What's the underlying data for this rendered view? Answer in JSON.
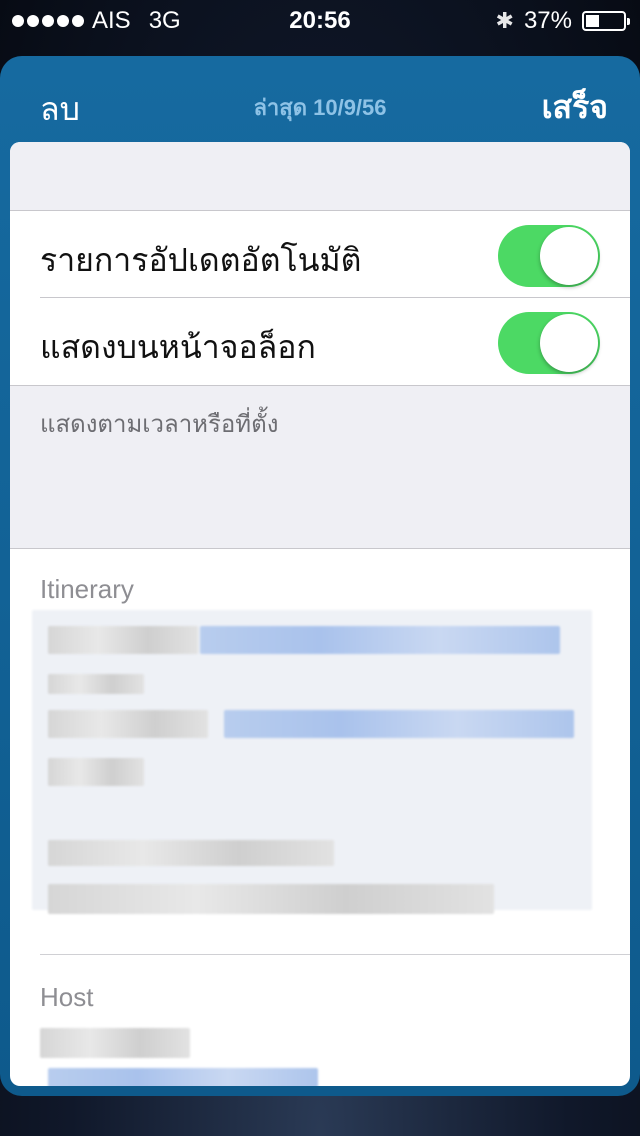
{
  "status_bar": {
    "carrier": "AIS",
    "network": "3G",
    "time": "20:56",
    "battery": "37%",
    "battery_level": 0.37,
    "icons": [
      "signal-dots-icon",
      "bluetooth-icon",
      "battery-icon"
    ]
  },
  "nav": {
    "left_label": "ลบ",
    "title": "ล่าสุด 10/9/56",
    "right_label": "เสร็จ"
  },
  "settings": {
    "rows": [
      {
        "label": "รายการอัปเดตอัตโนมัติ",
        "on": true
      },
      {
        "label": "แสดงบนหน้าจอล็อก",
        "on": true
      }
    ],
    "footer": "แสดงตามเวลาหรือที่ตั้ง"
  },
  "sections": {
    "itinerary_title": "Itinerary",
    "host_title": "Host"
  },
  "colors": {
    "accent": "#166aa0",
    "toggle_on": "#4cd964"
  }
}
